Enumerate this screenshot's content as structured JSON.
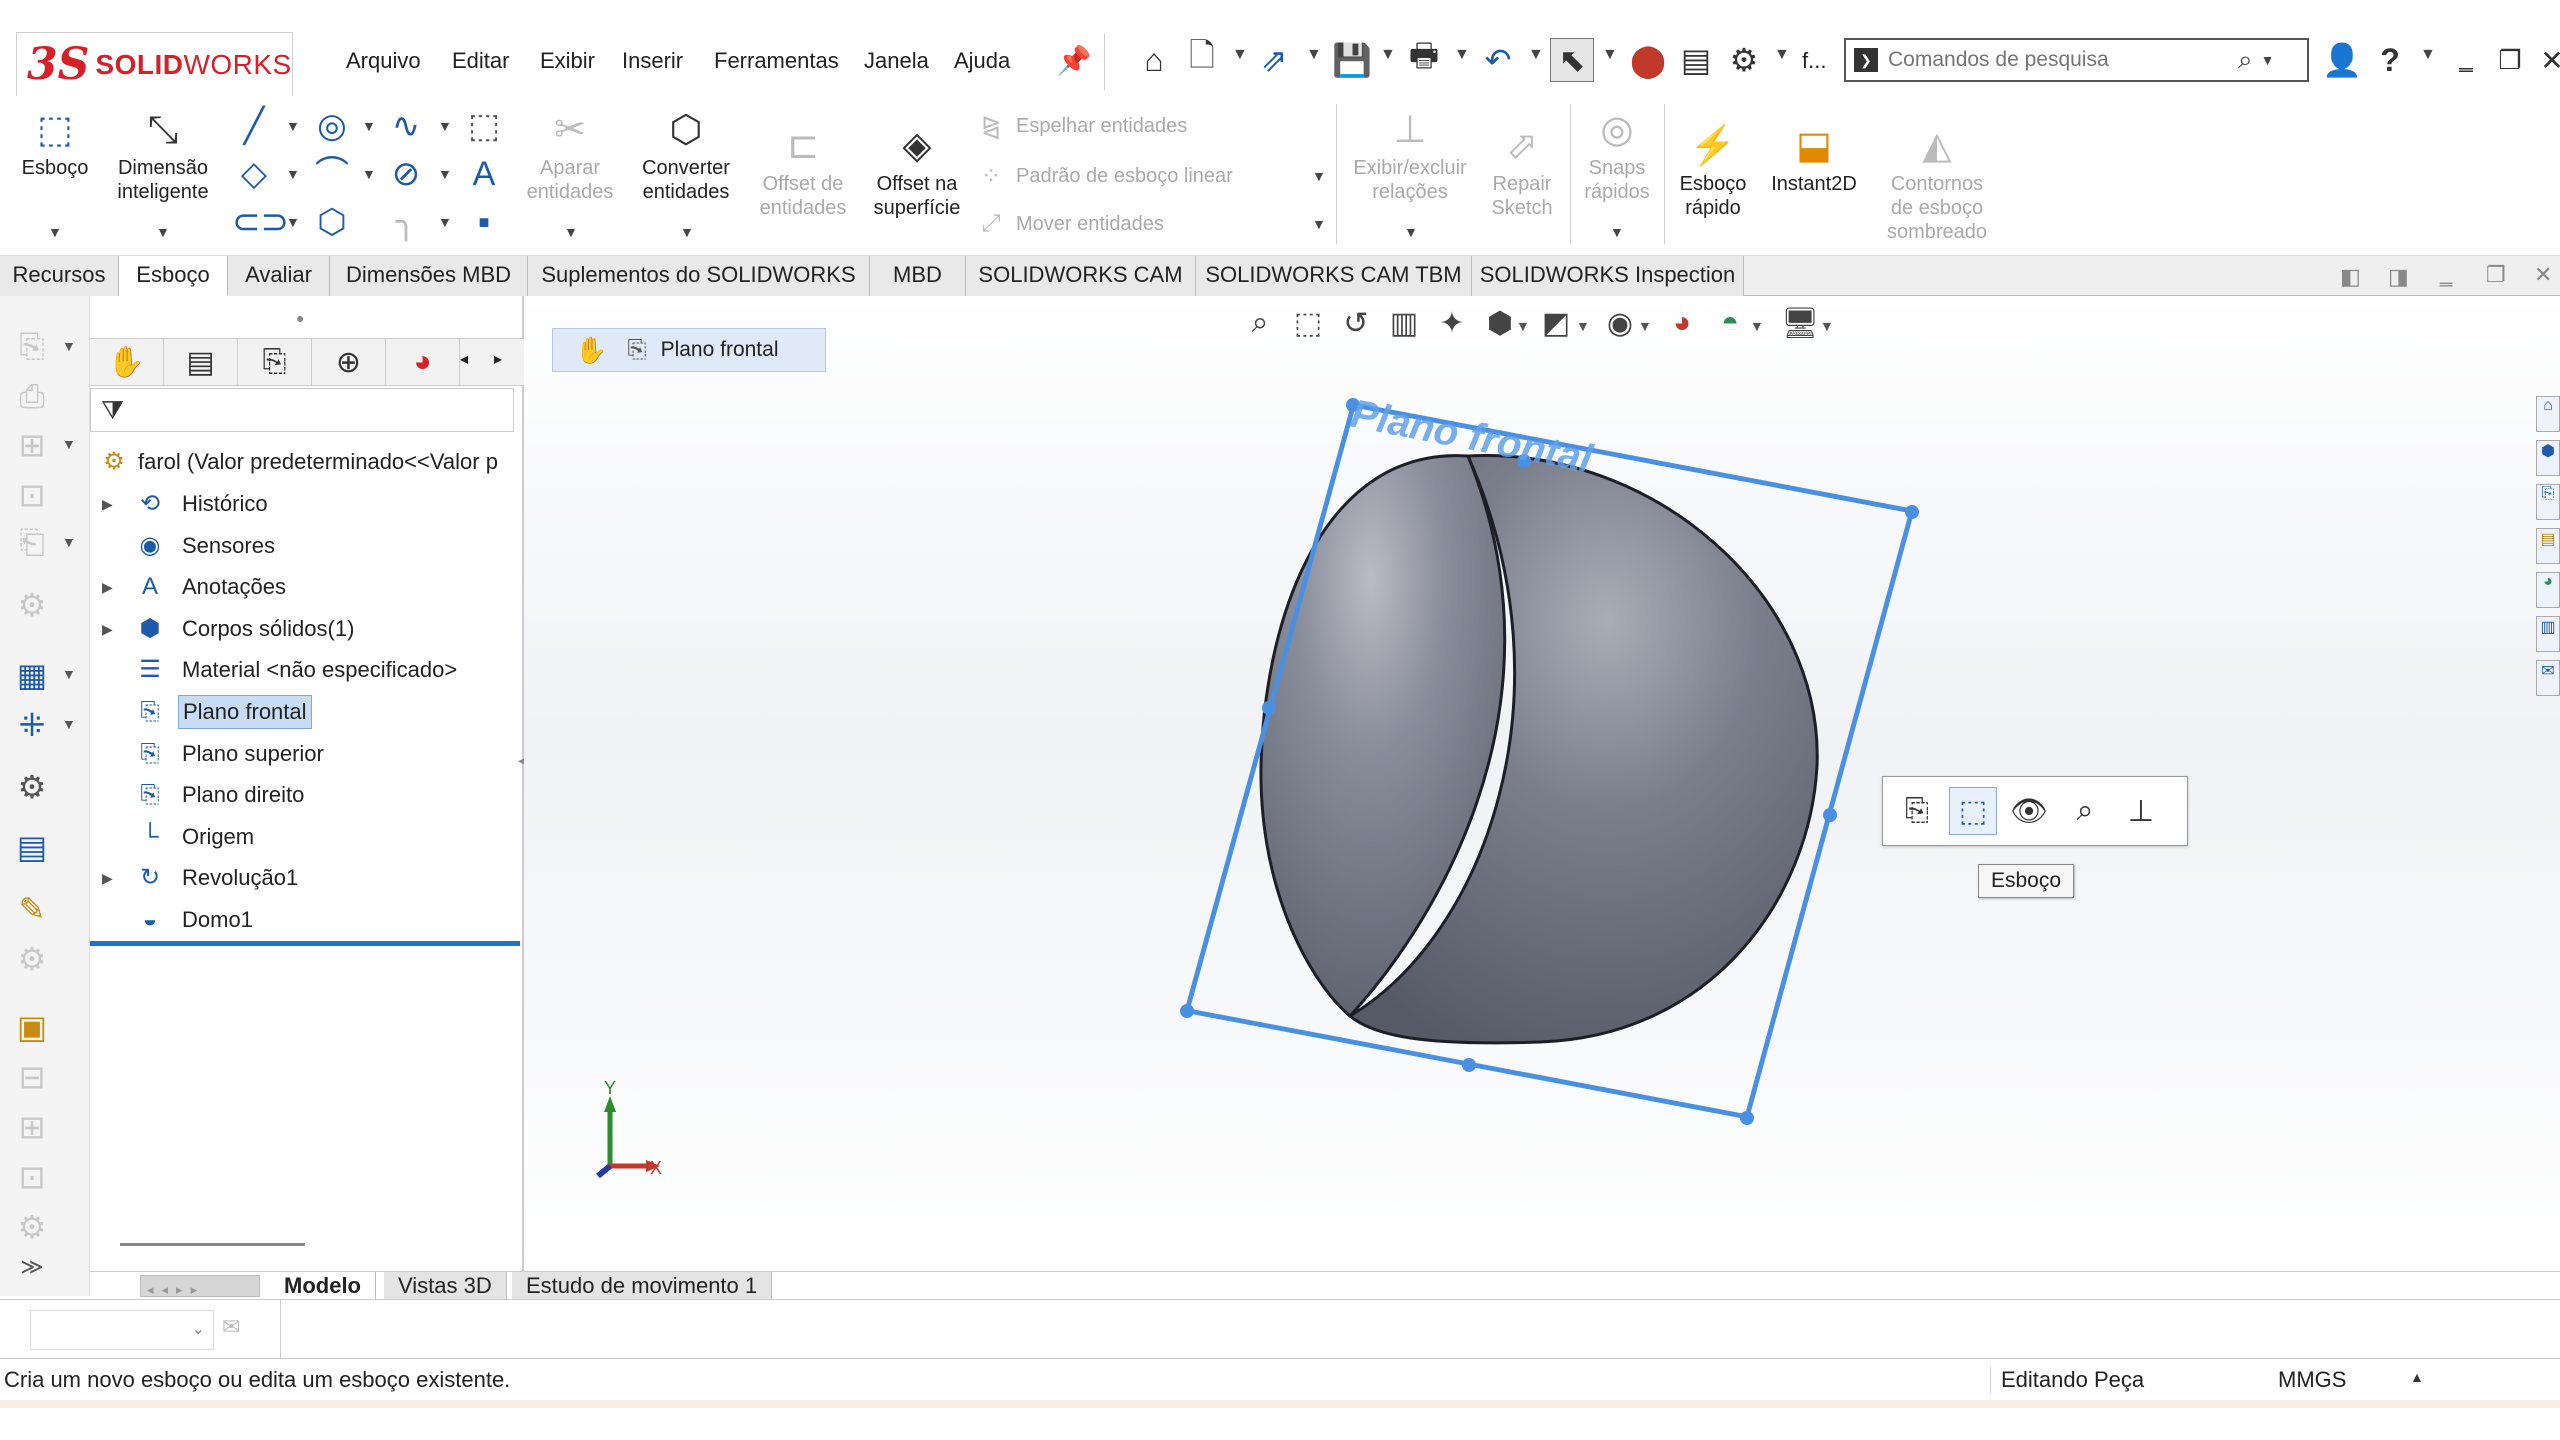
{
  "app": {
    "brand": "SOLIDWORKS",
    "brand_part1": "SOLID",
    "brand_part2": "WORKS",
    "brand_logo": "3S"
  },
  "menu": [
    "Arquivo",
    "Editar",
    "Exibir",
    "Inserir",
    "Ferramentas",
    "Janela",
    "Ajuda"
  ],
  "toolbar": {
    "ellipsis_label": "f...",
    "search_placeholder": "Comandos de pesquisa",
    "help_label": "?"
  },
  "ribbon": {
    "esboco": "Esboço",
    "dimensao1": "Dimensão",
    "dimensao2": "inteligente",
    "aparar1": "Aparar",
    "aparar2": "entidades",
    "converter1": "Converter",
    "converter2": "entidades",
    "offset1": "Offset de",
    "offset2": "entidades",
    "offsup1": "Offset na",
    "offsup2": "superfície",
    "espelhar": "Espelhar entidades",
    "padrao": "Padrão de esboço linear",
    "mover": "Mover entidades",
    "exibir1": "Exibir/excluir",
    "exibir2": "relações",
    "repair1": "Repair",
    "repair2": "Sketch",
    "snaps1": "Snaps",
    "snaps2": "rápidos",
    "rapido1": "Esboço",
    "rapido2": "rápido",
    "instant": "Instant2D",
    "contornos1": "Contornos",
    "contornos2": "de esboço",
    "contornos3": "sombreado"
  },
  "tabs": [
    "Recursos",
    "Esboço",
    "Avaliar",
    "Dimensões MBD",
    "Suplementos do SOLIDWORKS",
    "MBD",
    "SOLIDWORKS CAM",
    "SOLIDWORKS CAM TBM",
    "SOLIDWORKS Inspection"
  ],
  "active_tab": "Esboço",
  "tree": {
    "root": "farol  (Valor predeterminado<<Valor p",
    "items": [
      {
        "label": "Histórico",
        "icon": "history-icon",
        "expandable": true
      },
      {
        "label": "Sensores",
        "icon": "sensor-icon",
        "expandable": false
      },
      {
        "label": "Anotações",
        "icon": "annotation-icon",
        "expandable": true
      },
      {
        "label": "Corpos sólidos(1)",
        "icon": "solid-bodies-icon",
        "expandable": true
      },
      {
        "label": "Material <não especificado>",
        "icon": "material-icon",
        "expandable": false
      },
      {
        "label": "Plano frontal",
        "icon": "plane-icon",
        "expandable": false,
        "selected": true
      },
      {
        "label": "Plano superior",
        "icon": "plane-icon",
        "expandable": false
      },
      {
        "label": "Plano direito",
        "icon": "plane-icon",
        "expandable": false
      },
      {
        "label": "Origem",
        "icon": "origin-icon",
        "expandable": false
      },
      {
        "label": "Revolução1",
        "icon": "revolve-icon",
        "expandable": true
      },
      {
        "label": "Domo1",
        "icon": "dome-icon",
        "expandable": false
      }
    ]
  },
  "breadcrumb": {
    "label": "Plano frontal"
  },
  "viewport": {
    "plane_label": "Plano frontal",
    "tooltip": "Esboço",
    "triad_y": "Y",
    "triad_x": "X"
  },
  "bottom_tabs": [
    "Modelo",
    "Vistas 3D",
    "Estudo de movimento 1"
  ],
  "status": {
    "message": "Cria um novo esboço ou edita um esboço existente.",
    "mode": "Editando Peça",
    "units": "MMGS"
  },
  "colors": {
    "accent": "#1d72c9",
    "brand": "#d61f26",
    "plane": "#4a90e2",
    "model": "#6b6f7c"
  }
}
